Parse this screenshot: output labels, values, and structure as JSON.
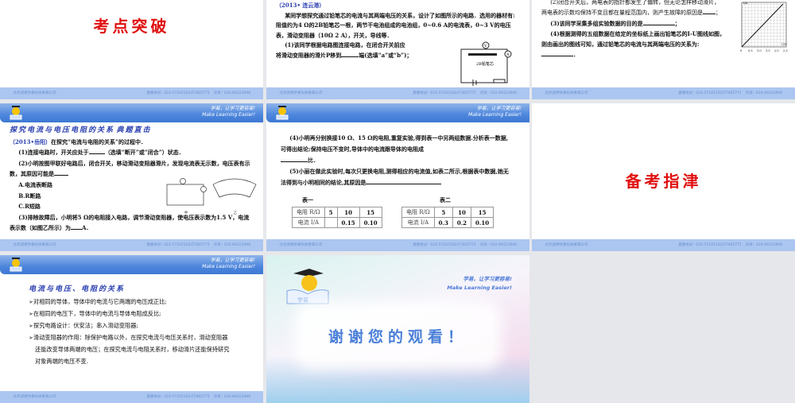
{
  "footer": {
    "company": "北京润博学易科技有限公司",
    "contact": "客服电话：010-57105162/57405771　传真：010-89313898"
  },
  "header": {
    "slogan_cn": "学易，让学习更容易!",
    "slogan_en": "Make Learning Easier!"
  },
  "slides": [
    {
      "title": "考点突破"
    },
    {
      "source": "（2013• 连云港）",
      "lines": [
        "某同学想探究通过铅笔芯的电流与其两端电压的关系，设计了如图所示的电路．选用的器材有:阻值约为4 Ω的2B铅笔芯一根，两节干电池组成的电池组，0~0.6 A的电流表，0~3 V的电压表，滑动变阻器（10Ω 2 A），开关，导线等．",
        "(1)该同学根据电路图连接电路，在闭合开关前应",
        "将滑动变阻器的滑片P移到",
        "端(选填“a”或“b”)；"
      ],
      "figure_label": "2B铅笔芯"
    },
    {
      "lines": [
        "(2)闭合开关后，两电表的指针都发生了偏转，但无论怎样移动滑片，两电表的示数均保持不变且都在量程范围内，则产生故障的原因是",
        "；",
        "(3)该同学采集多组实验数据的目的是",
        "；",
        "(4)根据测得的五组数据在给定的坐标纸上画出铅笔芯的I-U图线如图，则由画出的图线可知，通过铅笔芯的电流与其两端电压的关系为:",
        "．"
      ],
      "graph": {
        "ylabel": "I/A",
        "xlabel": "U/V",
        "xticks": [
          "0",
          "0.5",
          "1.0",
          "1.5",
          "2.0",
          "2.5"
        ]
      }
    },
    {
      "section": "探究电流与电压电阻的关系",
      "tag": "典题直击",
      "source": "（2013•岳阳）",
      "intro": "在探究“电流与电阻的关系”的过程中．",
      "q1a": "(1)连接电路时，开关应处于",
      "q1b": "（选填“断开”或“闭合”）状态．",
      "q2": "(2)小明按图甲联好电路后，闭合开关，移动滑动变阻器滑片，发现电流表无示数，电压表有示数，其原因可能是",
      "options": [
        "A.电流表断路",
        "B.R断路",
        "C.R短路"
      ],
      "q3a": "(3)排除故障后，小明将5 Ω的电阻接入电路，调节滑动变阻器，使电压表示数为1.5 V，电流表示数（如图乙所示）为",
      "q3b": "A．",
      "fig_labels": [
        "甲",
        "乙"
      ]
    },
    {
      "q4a": "(4)小明再分别换接10 Ω、15 Ω的电阻,重复实验,得到表一中另两组数据.分析表一数据,可得出结论;保持电压不变时,导体中的电流跟导体的电阻成",
      "q4b": "比．",
      "q5": "(5)小丽在做此实验时,每次只更换电阻,测得相应的电流值,如表二所示,根据表中数据,她无法得到与小明相同的结论,其原因是",
      "table1": {
        "caption": "表一",
        "rows": [
          [
            "电阻 R/Ω",
            "5",
            "10",
            "15"
          ],
          [
            "电流 I/A",
            "",
            "0.15",
            "0.10"
          ]
        ]
      },
      "table2": {
        "caption": "表二",
        "rows": [
          [
            "电阻 R/Ω",
            "5",
            "10",
            "15"
          ],
          [
            "电流 I/A",
            "0.3",
            "0.2",
            "0.10"
          ]
        ]
      }
    },
    {
      "title": "备考指津"
    },
    {
      "section": "电流与电压、电阻的关系",
      "bullets": [
        "对相同的导体，导体中的电流与它两端的电压成正比;",
        "在相同的电压下，导体中的电流与导体电阻成反比;",
        "探究电路设计：伏安法；串入滑动变阻器;",
        "滑动变阻器的作用：除保护电路以外，在探究电流与电压关系时，滑动变阻器还能改变导体两端的电压；在探究电流与电阻关系时，移动滑片还能保持研究对象两端的电压不变."
      ]
    },
    {
      "logo_text": "学易",
      "title": "谢谢您的观看！"
    }
  ]
}
